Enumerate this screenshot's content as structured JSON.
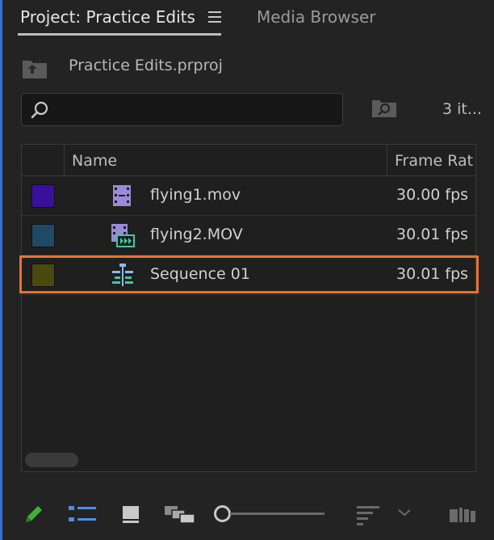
{
  "tabs": {
    "active": "Project: Practice Edits",
    "inactive": "Media Browser"
  },
  "project": {
    "file_name": "Practice Edits.prproj",
    "item_count": "3 it..."
  },
  "search": {
    "value": "",
    "placeholder": ""
  },
  "columns": {
    "name": "Name",
    "frame_rate": "Frame Rat"
  },
  "items": [
    {
      "color": "#3a0f9c",
      "icon": "video-clip-icon",
      "name": "flying1.mov",
      "frame_rate": "30.00 fps"
    },
    {
      "color": "#1e4a66",
      "icon": "av-clip-icon",
      "name": "flying2.MOV",
      "frame_rate": "30.01 fps"
    },
    {
      "color": "#4a4a10",
      "icon": "sequence-icon",
      "name": "Sequence 01",
      "frame_rate": "30.01 fps"
    }
  ],
  "colors": {
    "accent": "#3a6fd8",
    "highlight": "#e8722a",
    "new-item": "#3fae3a"
  },
  "toolbar": {
    "icons": [
      "pencil-icon",
      "list-view-icon",
      "icon-view-icon",
      "freeform-view-icon",
      "zoom-slider",
      "sort-icon",
      "chevron-down-icon",
      "automate-to-sequence-icon"
    ]
  }
}
